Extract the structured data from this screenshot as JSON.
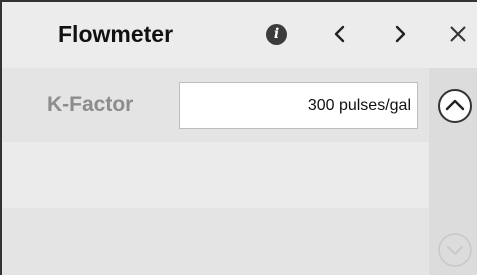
{
  "header": {
    "title": "Flowmeter",
    "info_icon": "info-icon",
    "prev_icon": "chevron-left-icon",
    "next_icon": "chevron-right-icon",
    "close_icon": "close-icon"
  },
  "fields": [
    {
      "label": "K-Factor",
      "value": "300 pulses/gal"
    }
  ],
  "scroll": {
    "up_icon": "chevron-up-icon",
    "down_icon": "chevron-down-icon"
  },
  "colors": {
    "header_bg": "#ececec",
    "row_bg": "#e4e4e4",
    "rail_bg": "#dcdcdc",
    "label": "#8c8c8c",
    "text": "#111111"
  }
}
